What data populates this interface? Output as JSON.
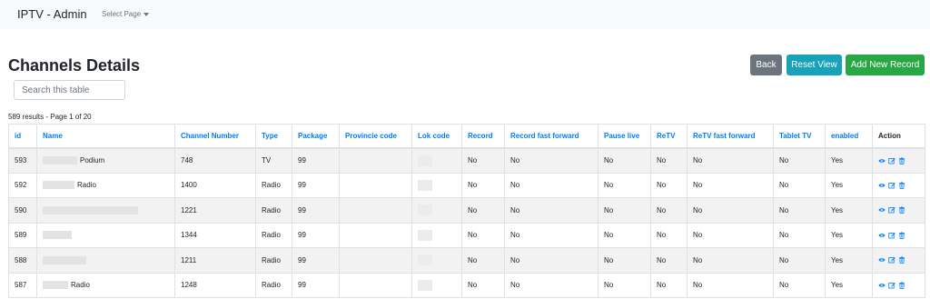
{
  "navbar": {
    "brand": "IPTV - Admin",
    "select_page": "Select Page"
  },
  "page_title": "Channels Details",
  "buttons": {
    "back": "Back",
    "reset_view": "Reset View",
    "add_new_record": "Add New Record"
  },
  "search": {
    "placeholder": "Search this table",
    "value": ""
  },
  "results_text": "589 results - Page 1 of 20",
  "table": {
    "columns": [
      "id",
      "Name",
      "Channel Number",
      "Type",
      "Package",
      "Provincie code",
      "Lok code",
      "Record",
      "Record fast forward",
      "Pause live",
      "ReTV",
      "ReTV fast forward",
      "Tablet TV",
      "enabled",
      "Action"
    ],
    "rows": [
      {
        "id": "593",
        "name": "Podium",
        "channel_number": "748",
        "type": "TV",
        "package": "99",
        "provincie_code": "",
        "record": "No",
        "record_ff": "No",
        "pause_live": "No",
        "retv": "No",
        "retv_ff": "No",
        "tablet_tv": "No",
        "enabled": "Yes"
      },
      {
        "id": "592",
        "name": "Radio",
        "channel_number": "1400",
        "type": "Radio",
        "package": "99",
        "provincie_code": "",
        "record": "No",
        "record_ff": "No",
        "pause_live": "No",
        "retv": "No",
        "retv_ff": "No",
        "tablet_tv": "No",
        "enabled": "Yes"
      },
      {
        "id": "590",
        "name": "",
        "channel_number": "1221",
        "type": "Radio",
        "package": "99",
        "provincie_code": "",
        "record": "No",
        "record_ff": "No",
        "pause_live": "No",
        "retv": "No",
        "retv_ff": "No",
        "tablet_tv": "No",
        "enabled": "Yes"
      },
      {
        "id": "589",
        "name": "",
        "channel_number": "1344",
        "type": "Radio",
        "package": "99",
        "provincie_code": "",
        "record": "No",
        "record_ff": "No",
        "pause_live": "No",
        "retv": "No",
        "retv_ff": "No",
        "tablet_tv": "No",
        "enabled": "Yes"
      },
      {
        "id": "588",
        "name": "",
        "channel_number": "1211",
        "type": "Radio",
        "package": "99",
        "provincie_code": "",
        "record": "No",
        "record_ff": "No",
        "pause_live": "No",
        "retv": "No",
        "retv_ff": "No",
        "tablet_tv": "No",
        "enabled": "Yes"
      },
      {
        "id": "587",
        "name": "Radio",
        "channel_number": "1248",
        "type": "Radio",
        "package": "99",
        "provincie_code": "",
        "record": "No",
        "record_ff": "No",
        "pause_live": "No",
        "retv": "No",
        "retv_ff": "No",
        "tablet_tv": "No",
        "enabled": "Yes"
      }
    ]
  },
  "action_icons": [
    "eye-icon",
    "edit-icon",
    "trash-icon"
  ],
  "colors": {
    "link": "#007bff",
    "back": "#6c757d",
    "reset": "#17a2b8",
    "add": "#28a745",
    "navbar": "#f8f9fa"
  }
}
